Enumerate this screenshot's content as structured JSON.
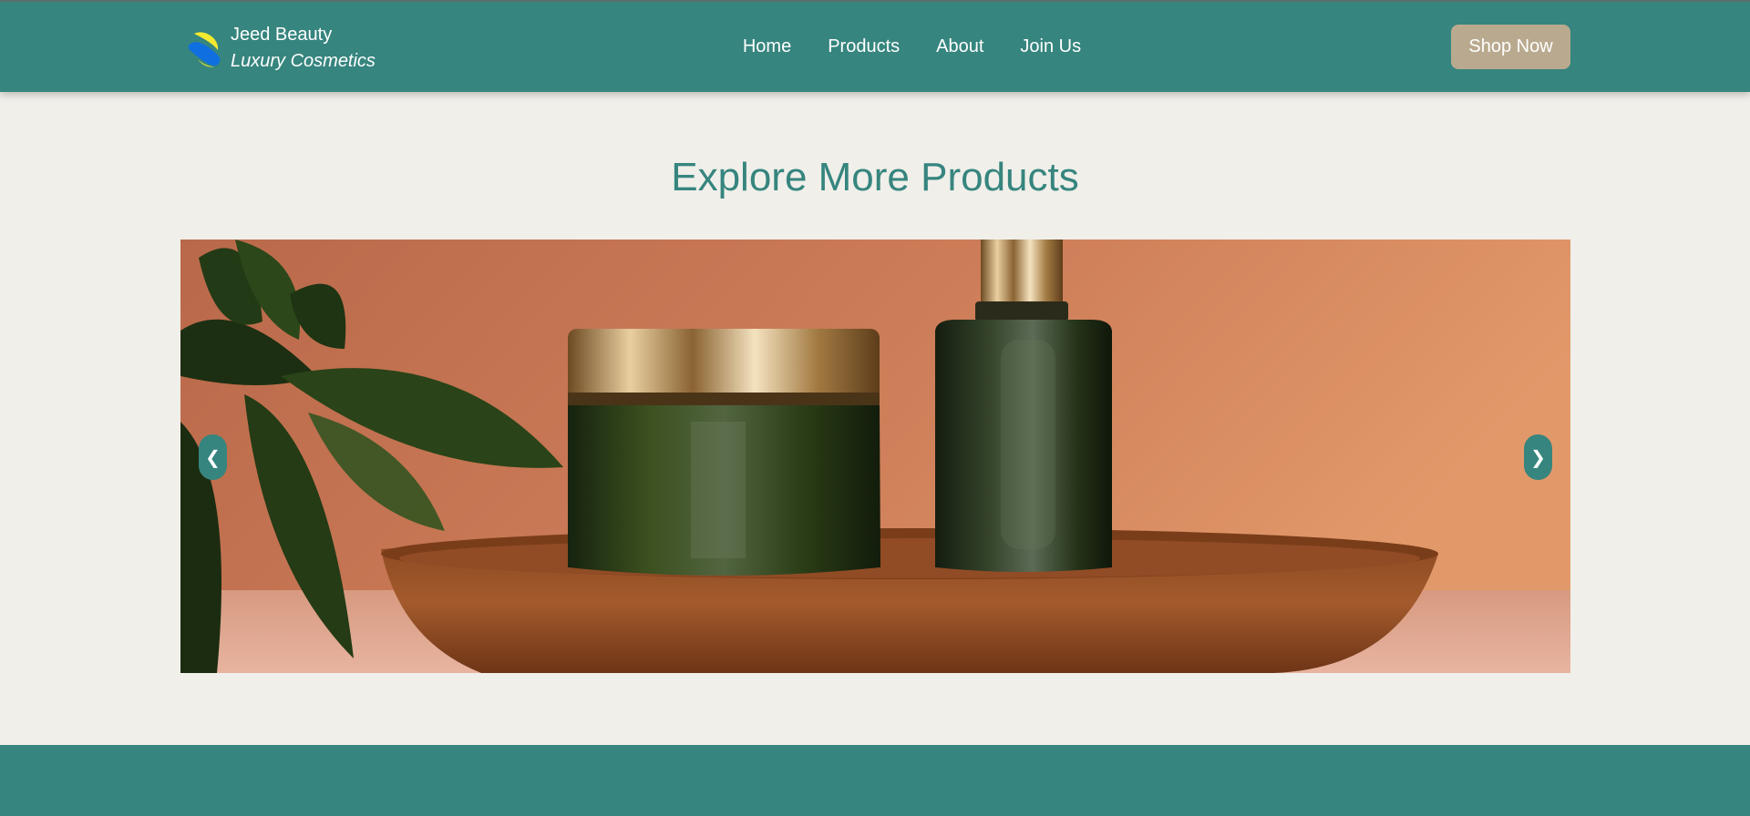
{
  "brand": {
    "name": "Jeed Beauty",
    "tagline": "Luxury Cosmetics",
    "logo_icon": "beauty-logo-icon",
    "logo_colors": [
      "#0f6fe0",
      "#f3e92f"
    ]
  },
  "nav": {
    "items": [
      {
        "label": "Home"
      },
      {
        "label": "Products"
      },
      {
        "label": "About"
      },
      {
        "label": "Join Us"
      }
    ],
    "cta_label": "Shop Now"
  },
  "main": {
    "title": "Explore More Products",
    "carousel": {
      "prev_symbol": "❮",
      "next_symbol": "❯",
      "prev_icon": "chevron-left-icon",
      "next_icon": "chevron-right-icon"
    }
  },
  "colors": {
    "primary": "#36857e",
    "background": "#f0efea",
    "cta": "#b9aa8f",
    "text_light": "#ffffff"
  }
}
